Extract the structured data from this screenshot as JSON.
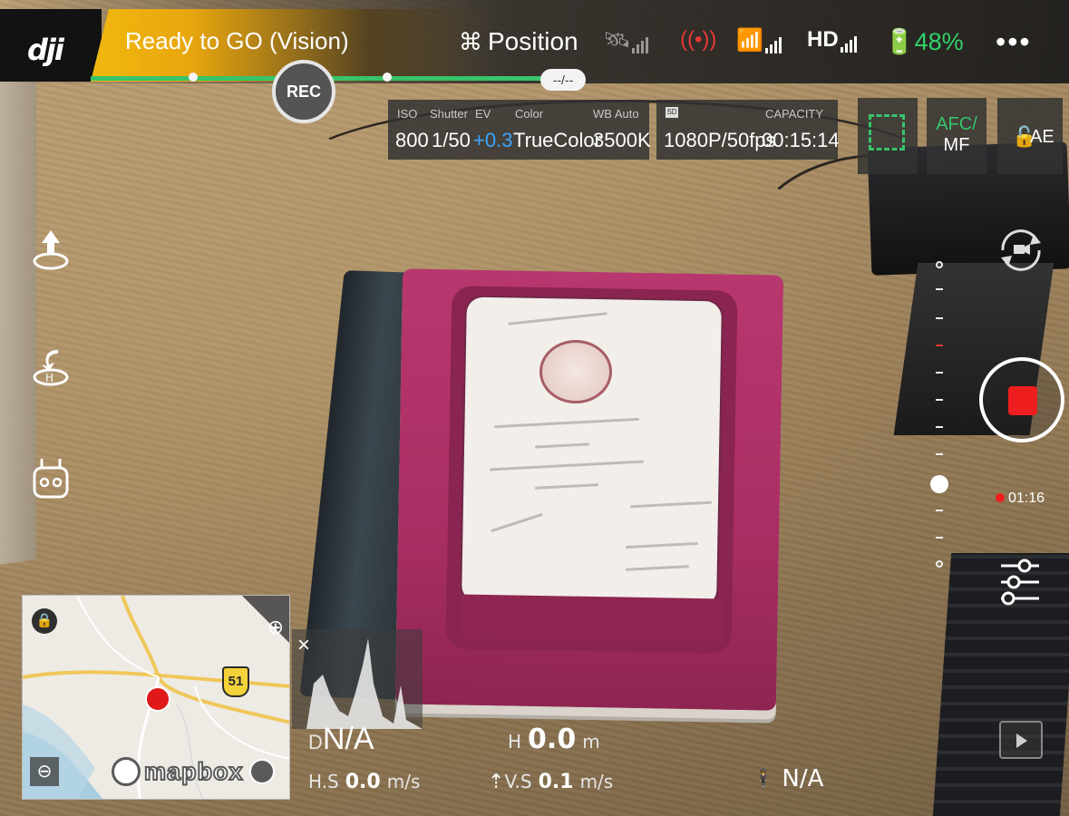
{
  "app": {
    "logo": "dji"
  },
  "status": {
    "text": "Ready to GO (Vision)",
    "color": "#f1b80f"
  },
  "flight_mode": {
    "label": "Position",
    "icon": "drone-icon"
  },
  "signals": {
    "gps": {
      "icon": "satellite-icon"
    },
    "obstacle": {
      "icon": "obstacle-sensing-icon",
      "color": "#e53935"
    },
    "remote": {
      "icon": "remote-controller-icon"
    },
    "video": {
      "label": "HD"
    }
  },
  "battery": {
    "percent": "48%",
    "color": "#31d26a"
  },
  "menu": {
    "more_icon": "more-icon"
  },
  "timeline": {
    "chip": "--/--",
    "rec_label": "REC"
  },
  "camera": {
    "iso_label": "ISO",
    "iso_value": "800",
    "shutter_label": "Shutter",
    "shutter_value": "1/50",
    "ev_label": "EV",
    "ev_value": "+0.3",
    "color_label": "Color",
    "color_value": "TrueColor",
    "wb_label": "WB Auto",
    "wb_value": "3500K",
    "capacity_label": "CAPACITY",
    "resolution_value": "1080P/50fps",
    "capacity_value": "00:15:14"
  },
  "focus": {
    "afc_label": "AFC/",
    "mf_label": "MF",
    "ae_label": "AE"
  },
  "left_controls": [
    {
      "name": "takeoff-icon"
    },
    {
      "name": "return-home-icon"
    },
    {
      "name": "remote-controller-icon"
    }
  ],
  "right_controls": {
    "record_time": "01:16",
    "camera_switch": "camera-switch-icon",
    "settings": "camera-settings-icon",
    "playback": "playback-icon"
  },
  "map": {
    "highway": "51",
    "brand": "mapbox",
    "lock_icon": "lock-icon",
    "target_icon": "crosshair-icon",
    "zoom_icon": "zoom-out-icon"
  },
  "histogram": {
    "close": "×"
  },
  "telemetry": {
    "distance": "N/A",
    "distance_prefix": "D",
    "height_prefix": "H",
    "height_value": "0.0",
    "height_unit": "m",
    "hs_label": "H.S",
    "hs_value": "0.0",
    "hs_unit": "m/s",
    "vs_label": "V.S",
    "vs_value": "0.1",
    "vs_unit": "m/s",
    "altitude_value": "N/A"
  }
}
